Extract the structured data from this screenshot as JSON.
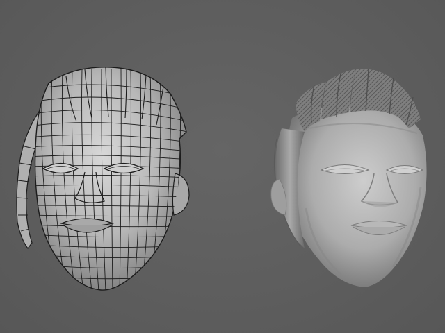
{
  "scene": {
    "background_color": "#5f5f5f",
    "models": [
      {
        "id": "wireframe",
        "shading": "wireframe-over-clay",
        "base_color": "#b9b9b9",
        "wire_color": "#1c1c1c"
      },
      {
        "id": "sculpt",
        "shading": "clay-sculpt",
        "base_color": "#b3b3b3",
        "shadow_color": "#6e6e6e"
      }
    ]
  }
}
